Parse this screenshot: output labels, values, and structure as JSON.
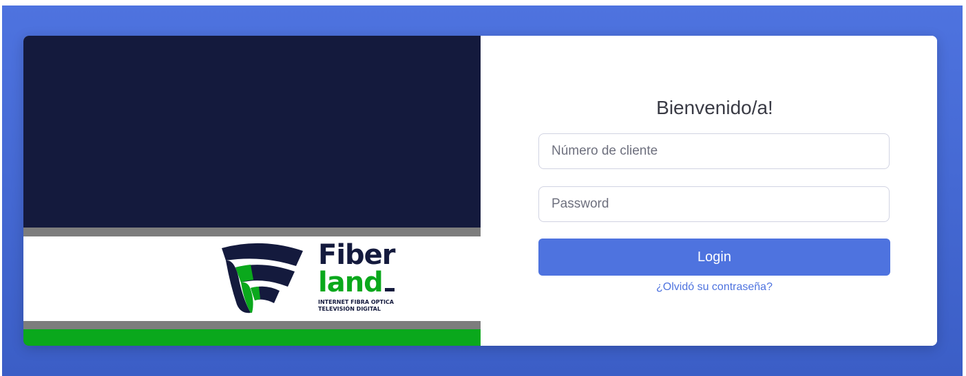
{
  "brand": {
    "word_top": "Fiber",
    "word_bottom": "land",
    "tagline_line1": "INTERNET FIBRA OPTICA",
    "tagline_line2": "TELEVISIÓN DIGITAL",
    "colors": {
      "navy": "#141a3d",
      "green": "#0aa81c",
      "gray": "#7d7d7d"
    }
  },
  "form": {
    "title": "Bienvenido/a!",
    "client_placeholder": "Número de cliente",
    "password_placeholder": "Password",
    "login_label": "Login",
    "forgot_label": "¿Olvidó su contraseña?",
    "accent_color": "#4e73df"
  }
}
